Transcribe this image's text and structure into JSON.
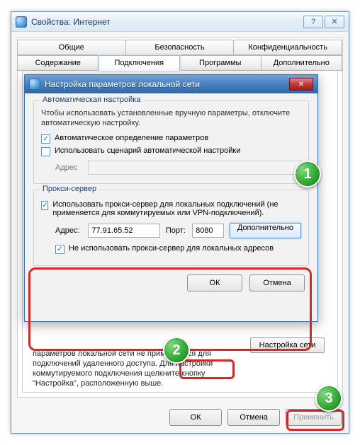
{
  "parent": {
    "title": "Свойства: Интернет",
    "help_icon": "?",
    "tabs_row1": [
      "Общие",
      "Безопасность",
      "Конфиденциальность"
    ],
    "tabs_row2": [
      "Содержание",
      "Подключения",
      "Программы",
      "Дополнительно"
    ],
    "active_tab": "Подключения",
    "lan_button": "Настройка сети",
    "fragment_text": "параметров локальной сети не применяются для подключений удаленного доступа. Для настройки коммутируемого подключения щелкните кнопку \"Настройка\", расположенную выше.",
    "ok": "ОК",
    "cancel": "Отмена",
    "apply": "Применить"
  },
  "child": {
    "title": "Настройка параметров локальной сети",
    "auto": {
      "legend": "Автоматическая настройка",
      "hint": "Чтобы использовать установленные вручную параметры, отключите автоматическую настройку.",
      "detect": {
        "label": "Автоматическое определение параметров",
        "checked": true
      },
      "script": {
        "label": "Использовать сценарий автоматической настройки",
        "checked": false
      },
      "addr_label": "Адрес",
      "addr_value": ""
    },
    "proxy": {
      "legend": "Прокси-сервер",
      "use": {
        "label": "Использовать прокси-сервер для локальных подключений (не применяется для коммутируемых или VPN-подключений).",
        "checked": true
      },
      "addr_label": "Адрес:",
      "addr_value": "77.91.65.52",
      "port_label": "Порт:",
      "port_value": "8080",
      "advanced": "Дополнительно",
      "bypass": {
        "label": "Не использовать прокси-сервер для локальных адресов",
        "checked": true
      }
    },
    "ok": "ОК",
    "cancel": "Отмена"
  },
  "badges": {
    "b1": "1",
    "b2": "2",
    "b3": "3"
  }
}
